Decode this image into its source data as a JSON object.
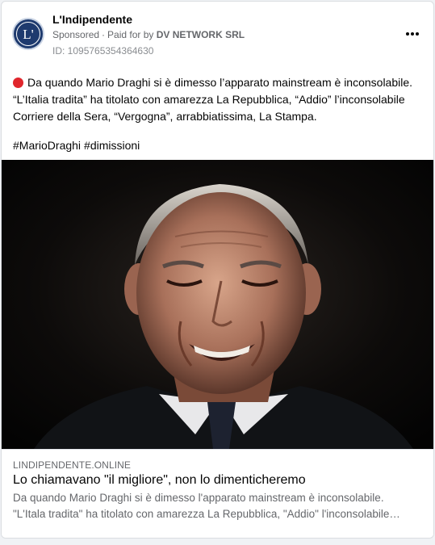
{
  "post": {
    "page_name": "L'Indipendente",
    "avatar_text": "L'",
    "sponsored_label": "Sponsored",
    "paid_for_prefix": "Paid for by",
    "payer": "DV NETWORK SRL",
    "ad_id": "ID: 1095765354364630",
    "more_icon": "more-horizontal-icon",
    "body_lines": [
      "Da quando Mario Draghi si è dimesso l’apparato mainstream è inconsolabile.",
      "“L’Italia tradita” ha titolato con amarezza La Repubblica, “Addio” l’inconsolabile",
      "Corriere della Sera, “Vergogna”, arrabbiatissima, La Stampa."
    ],
    "hashtags": [
      "#MarioDraghi",
      "#dimissioni"
    ],
    "status_icon": "red-circle-icon"
  },
  "link_preview": {
    "domain": "LINDIPENDENTE.ONLINE",
    "title": "Lo chiamavano \"il migliore\", non lo dimenticheremo",
    "description_lines": [
      "Da quando Mario Draghi si è dimesso l'apparato mainstream è inconsolabile.",
      "\"L'Itala tradita\" ha titolato con amarezza La Repubblica, \"Addio\" l'inconsolabile…"
    ]
  },
  "colors": {
    "red_dot": "#e0262c",
    "avatar_bg": "#1e3a6e",
    "secondary_text": "#65676b"
  }
}
